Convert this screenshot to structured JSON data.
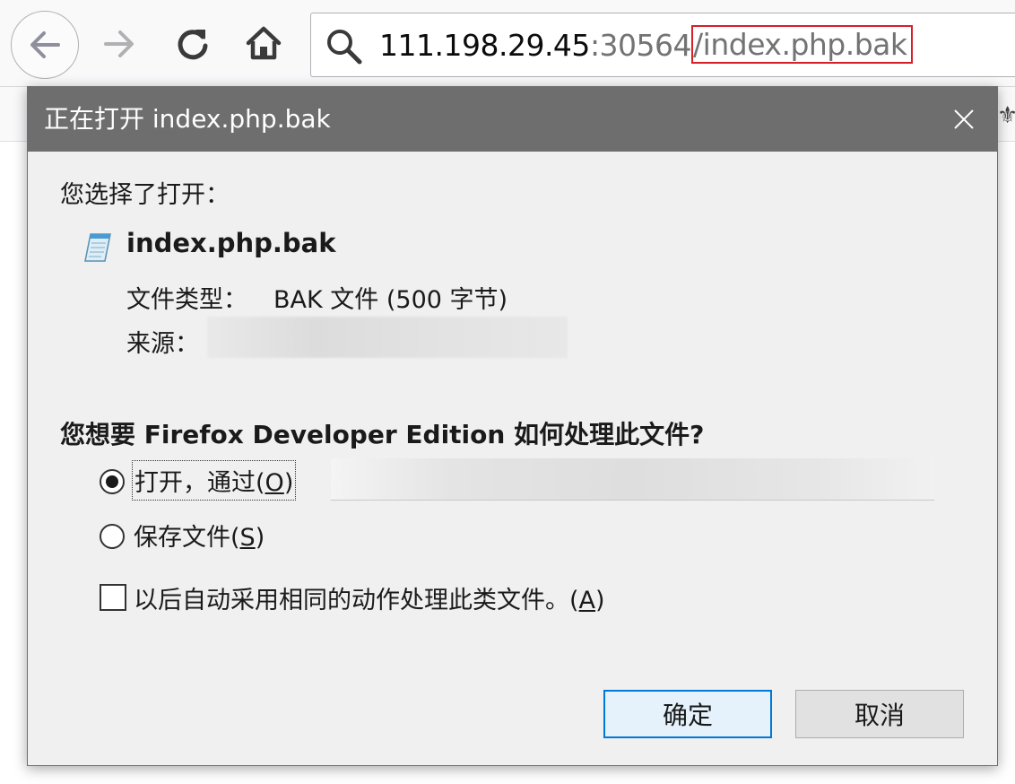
{
  "browser": {
    "url": {
      "host": "111.198.29.45",
      "port": ":30564",
      "path": "/index.php.bak"
    }
  },
  "dialog": {
    "title": "正在打开 index.php.bak",
    "intro": "您选择了打开：",
    "filename": "index.php.bak",
    "type_label": "文件类型：",
    "type_value": "BAK 文件 (500 字节)",
    "source_label": "来源：",
    "question": "您想要 Firefox Developer Edition 如何处理此文件?",
    "open_with_label": "打开，通过(",
    "open_with_key": "O",
    "open_with_suffix": ")",
    "save_label": "保存文件(",
    "save_key": "S",
    "save_suffix": ")",
    "remember_label": "以后自动采用相同的动作处理此类文件。(",
    "remember_key": "A",
    "remember_suffix": ")",
    "open_selected": true,
    "remember_checked": false,
    "ok_label": "确定",
    "cancel_label": "取消"
  },
  "colors": {
    "titlebar": "#6e6e6e",
    "url_highlight_border": "#d71f28",
    "default_button_border": "#0078d7"
  }
}
